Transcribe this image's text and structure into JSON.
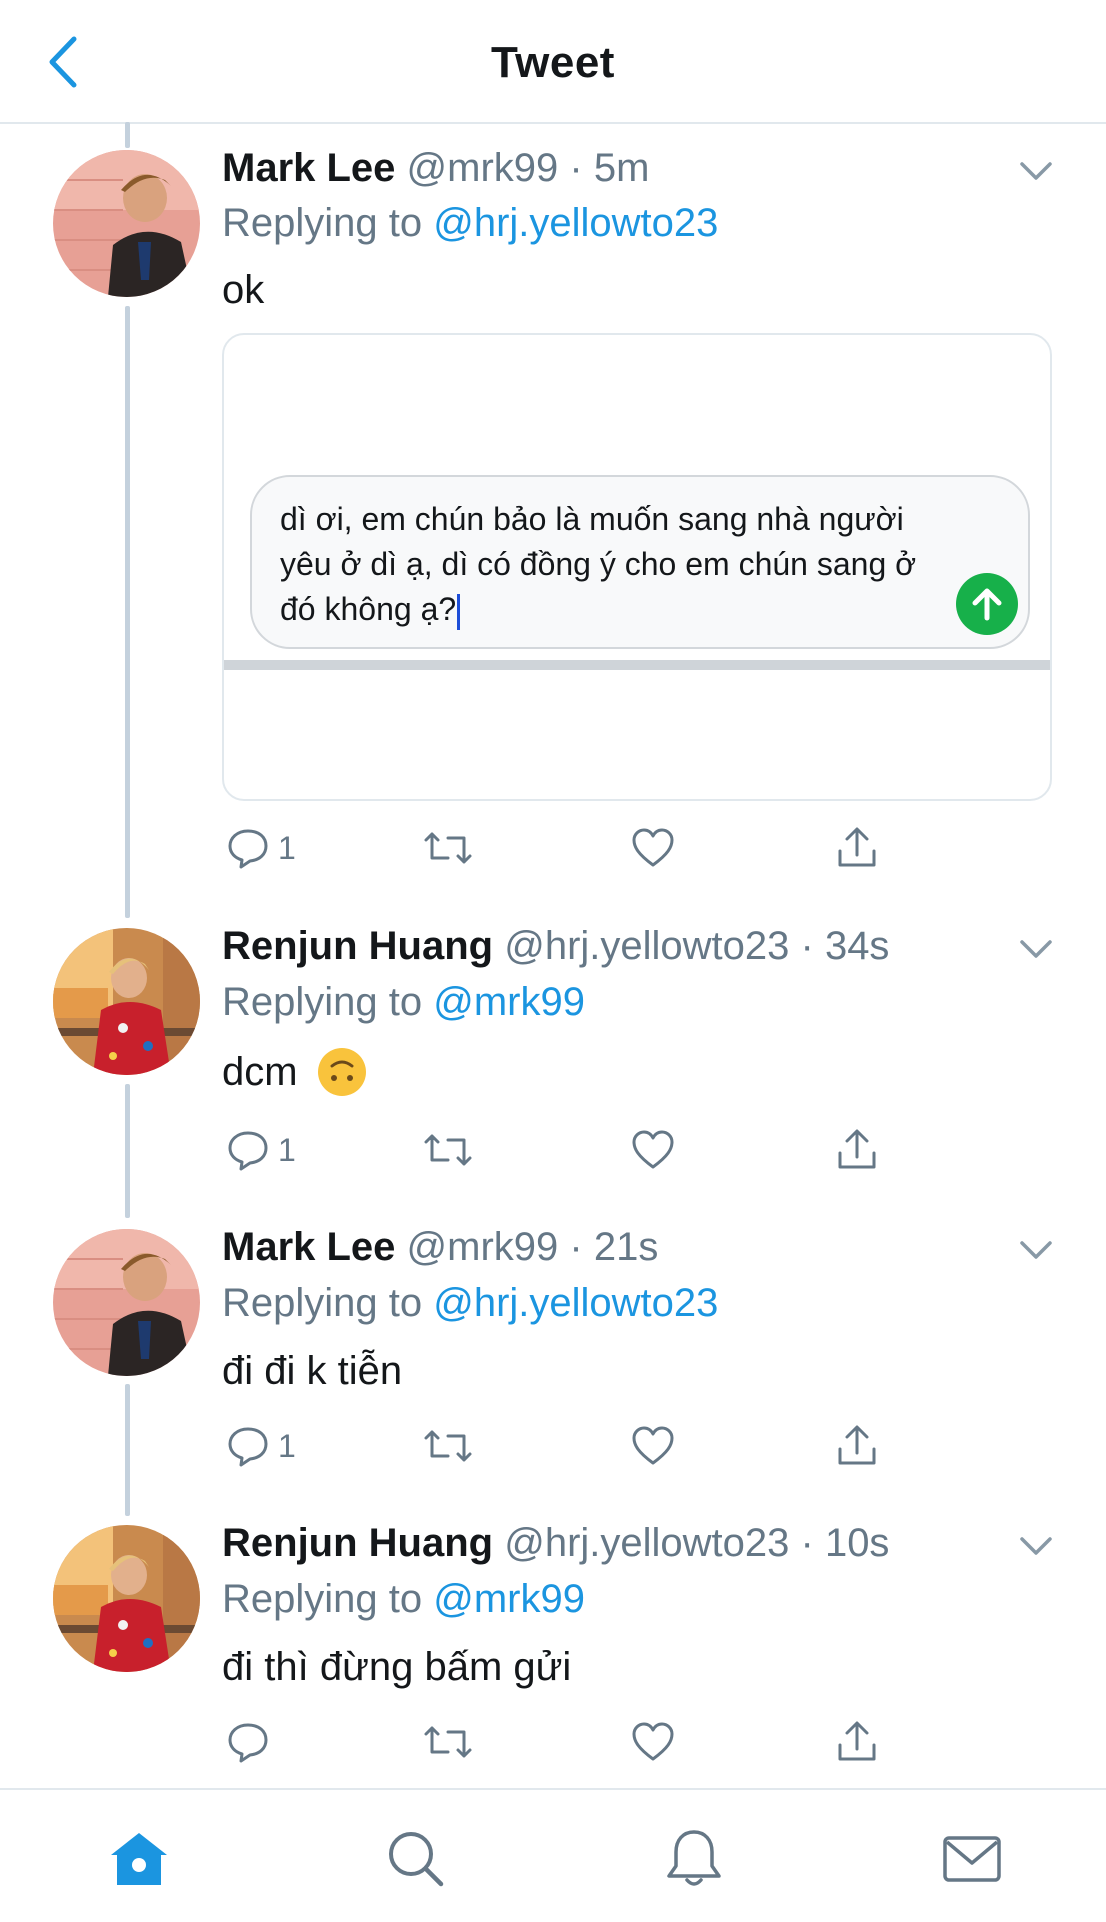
{
  "header": {
    "title": "Tweet"
  },
  "tweets": [
    {
      "name": "Mark Lee",
      "meta": "@mrk99 · 5m",
      "replying_prefix": "Replying to ",
      "replying_handle": "@hrj.yellowto23",
      "text": "ok",
      "reply_count": "1"
    },
    {
      "name": "Renjun Huang",
      "meta": "@hrj.yellowto23 · 34s",
      "replying_prefix": "Replying to ",
      "replying_handle": "@mrk99",
      "text": "dcm",
      "reply_count": "1"
    },
    {
      "name": "Mark Lee",
      "meta": "@mrk99 · 21s",
      "replying_prefix": "Replying to ",
      "replying_handle": "@hrj.yellowto23",
      "text": "đi đi k tiễn",
      "reply_count": "1"
    },
    {
      "name": "Renjun Huang",
      "meta": "@hrj.yellowto23 · 10s",
      "replying_prefix": "Replying to ",
      "replying_handle": "@mrk99",
      "text": "đi thì đừng bấm gửi",
      "reply_count": ""
    }
  ],
  "card": {
    "message": "dì ơi, em chún bảo là muốn sang nhà người yêu ở dì ạ, dì có đồng ý cho em chún sang ở đó không ạ?"
  },
  "colors": {
    "accent": "#1b95e0",
    "muted": "#657786",
    "send": "#17b04a"
  },
  "icons": {
    "back": "chevron-left-icon",
    "caret": "chevron-down-icon",
    "reply": "comment-icon",
    "retweet": "retweet-icon",
    "like": "heart-icon",
    "share": "share-icon",
    "home": "home-icon",
    "search": "search-icon",
    "notifications": "bell-icon",
    "messages": "mail-icon"
  }
}
